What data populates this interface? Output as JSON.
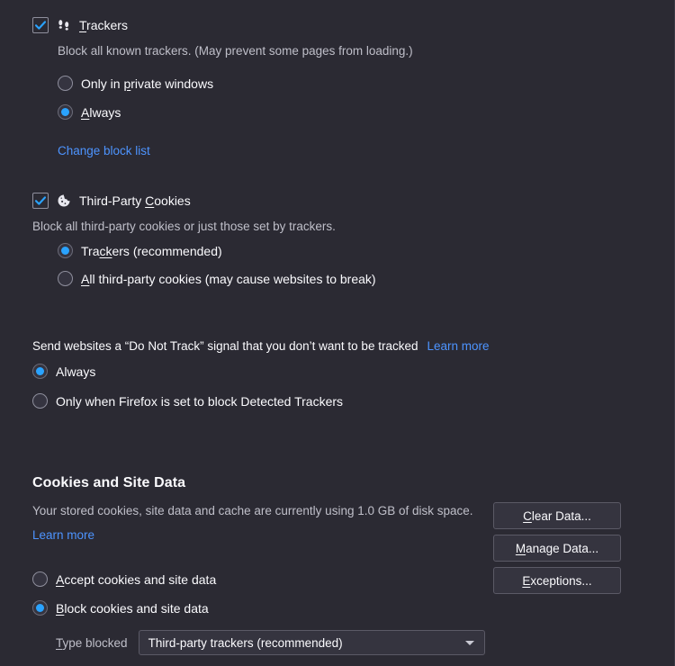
{
  "trackers": {
    "checkbox_checked": true,
    "icon": "footprints-icon",
    "title_pre": "T",
    "title_post": "rackers",
    "description": "Block all known trackers. (May prevent some pages from loading.)",
    "options": [
      {
        "label_pre": "Only in ",
        "label_key": "p",
        "label_post": "rivate windows",
        "selected": false
      },
      {
        "label_pre": "",
        "label_key": "A",
        "label_post": "lways",
        "selected": true
      }
    ],
    "change_block_list": "Change block list"
  },
  "third_party_cookies": {
    "checkbox_checked": true,
    "icon": "cookie-icon",
    "title_pre": "Third-Party ",
    "title_key": "C",
    "title_post": "ookies",
    "description": "Block all third-party cookies or just those set by trackers.",
    "options": [
      {
        "label_pre": "Tra",
        "label_key": "ck",
        "label_post": "ers (recommended)",
        "selected": true
      },
      {
        "label_pre": "",
        "label_key": "A",
        "label_post": "ll third-party cookies (may cause websites to break)",
        "selected": false
      }
    ]
  },
  "do_not_track": {
    "description": "Send websites a “Do Not Track” signal that you don’t want to be tracked",
    "learn_more": "Learn more",
    "options": [
      {
        "label": "Always",
        "selected": true
      },
      {
        "label": "Only when Firefox is set to block Detected Trackers",
        "selected": false
      }
    ]
  },
  "cookies_site_data": {
    "title": "Cookies and Site Data",
    "description": "Your stored cookies, site data and cache are currently using 1.0 GB of disk space.",
    "disk_usage": "1.0 GB",
    "learn_more": "Learn more",
    "buttons": [
      {
        "label_pre": "C",
        "label_post": "lear Data...",
        "name": "clear-data-button"
      },
      {
        "label_pre": "M",
        "label_post": "anage Data...",
        "name": "manage-data-button"
      },
      {
        "label_pre": "E",
        "label_post": "xceptions...",
        "name": "exceptions-button"
      }
    ],
    "options": [
      {
        "label_key": "A",
        "label_post": "ccept cookies and site data",
        "selected": false
      },
      {
        "label_key": "B",
        "label_post": "lock cookies and site data",
        "selected": true
      }
    ],
    "type_blocked_label_key": "T",
    "type_blocked_label_post": "ype blocked",
    "type_blocked_value": "Third-party trackers (recommended)"
  },
  "colors": {
    "background": "#2b2a33",
    "accent": "#2aa3ff",
    "link": "#4d94ff",
    "text": "#fbfbfe",
    "muted": "#bfbfc9"
  }
}
